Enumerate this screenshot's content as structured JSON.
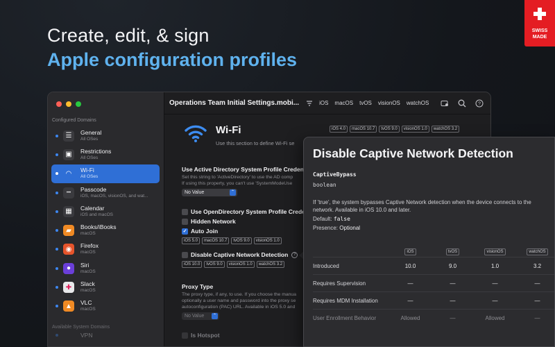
{
  "hero": {
    "line1": "Create, edit, & sign",
    "line2": "Apple configuration profiles"
  },
  "badge": {
    "line1": "SWISS",
    "line2": "MADE",
    "color": "#e41d23"
  },
  "window": {
    "title": "Operations Team Initial Settings.mobi...",
    "os_tabs": [
      "iOS",
      "macOS",
      "tvOS",
      "visionOS",
      "watchOS"
    ],
    "toolbar_icons": [
      "filter-icon",
      "sign-icon",
      "search-icon",
      "help-icon"
    ]
  },
  "sidebar": {
    "section_label": "Configured Domains",
    "section2_label": "Available System Domains",
    "items": [
      {
        "label": "General",
        "sub": "All OSes",
        "icon": "sliders-icon",
        "color": "#3a3a3e"
      },
      {
        "label": "Restrictions",
        "sub": "All OSes",
        "icon": "lock-icon",
        "color": "#3a3a3e"
      },
      {
        "label": "Wi-Fi",
        "sub": "All OSes",
        "icon": "wifi-icon",
        "color": "#2f6fd6",
        "selected": true
      },
      {
        "label": "Passcode",
        "sub": "iOS, macOS, visionOS, and wat...",
        "icon": "passcode-icon",
        "color": "#3a3a3e"
      },
      {
        "label": "Calendar",
        "sub": "iOS and macOS",
        "icon": "calendar-icon",
        "color": "#3a3a3e"
      },
      {
        "label": "Books/iBooks",
        "sub": "macOS",
        "icon": "books-icon",
        "color": "#f08a24"
      },
      {
        "label": "Firefox",
        "sub": "macOS",
        "icon": "firefox-icon",
        "color": "#e6542b"
      },
      {
        "label": "Siri",
        "sub": "macOS",
        "icon": "siri-icon",
        "color": "#6b3fd9"
      },
      {
        "label": "Slack",
        "sub": "macOS",
        "icon": "slack-icon",
        "color": "#e8e8ea"
      },
      {
        "label": "VLC",
        "sub": "macOS",
        "icon": "vlc-icon",
        "color": "#f08a24"
      }
    ],
    "partial_item": "VPN"
  },
  "wifi": {
    "title": "Wi-Fi",
    "desc": "Use this section to define Wi-Fi se",
    "badges": [
      "iOS 4.0",
      "macOS 10.7",
      "tvOS 9.0",
      "visionOS 1.0",
      "watchOS 3.2"
    ]
  },
  "fields": {
    "ad_title": "Use Active Directory System Profile Credent",
    "ad_desc1": "Set this string to 'ActiveDirectory' to use the AD comp",
    "ad_desc2": "If using this property, you can't use 'SystemModeUse",
    "ad_value": "No Value",
    "opendir": "Use OpenDirectory System Profile Crede",
    "hidden": "Hidden Network",
    "autojoin": "Auto Join",
    "autojoin_badges": [
      "iOS 5.0",
      "macOS 10.7",
      "tvOS 9.0",
      "visionOS 1.0"
    ],
    "captive": "Disable Captive Network Detection",
    "captive_badges": [
      "iOS 10.0",
      "tvOS 9.0",
      "visionOS 1.0",
      "watchOS 3.2"
    ],
    "proxy_title": "Proxy Type",
    "proxy_desc1": "The proxy type, if any, to use. If you choose the manua",
    "proxy_desc2": "optionally a user name and password into the proxy se",
    "proxy_desc3": "autoconfiguration (PAC) URL. Available in iOS 5.0 and",
    "proxy_value": "No Value",
    "hotspot": "Is Hotspot"
  },
  "popover": {
    "title": "Disable Captive Network Detection",
    "key": "CaptiveBypass",
    "type": "boolean",
    "desc": "If 'true', the system bypasses Captive Network detection when the device connects to the network. Available in iOS 10.0 and later.",
    "default_label": "Default:",
    "default_value": "false",
    "presence_label": "Presence:",
    "presence_value": "Optional",
    "columns": [
      "iOS",
      "tvOS",
      "visionOS",
      "watchOS"
    ],
    "rows": [
      {
        "label": "Introduced",
        "values": [
          "10.0",
          "9.0",
          "1.0",
          "3.2"
        ]
      },
      {
        "label": "Requires Supervision",
        "values": [
          "—",
          "—",
          "—",
          "—"
        ]
      },
      {
        "label": "Requires MDM Installation",
        "values": [
          "—",
          "—",
          "—",
          "—"
        ]
      },
      {
        "label": "User Enrollment Behavior",
        "values": [
          "Allowed",
          "—",
          "Allowed",
          "—"
        ],
        "faded": true
      }
    ]
  }
}
